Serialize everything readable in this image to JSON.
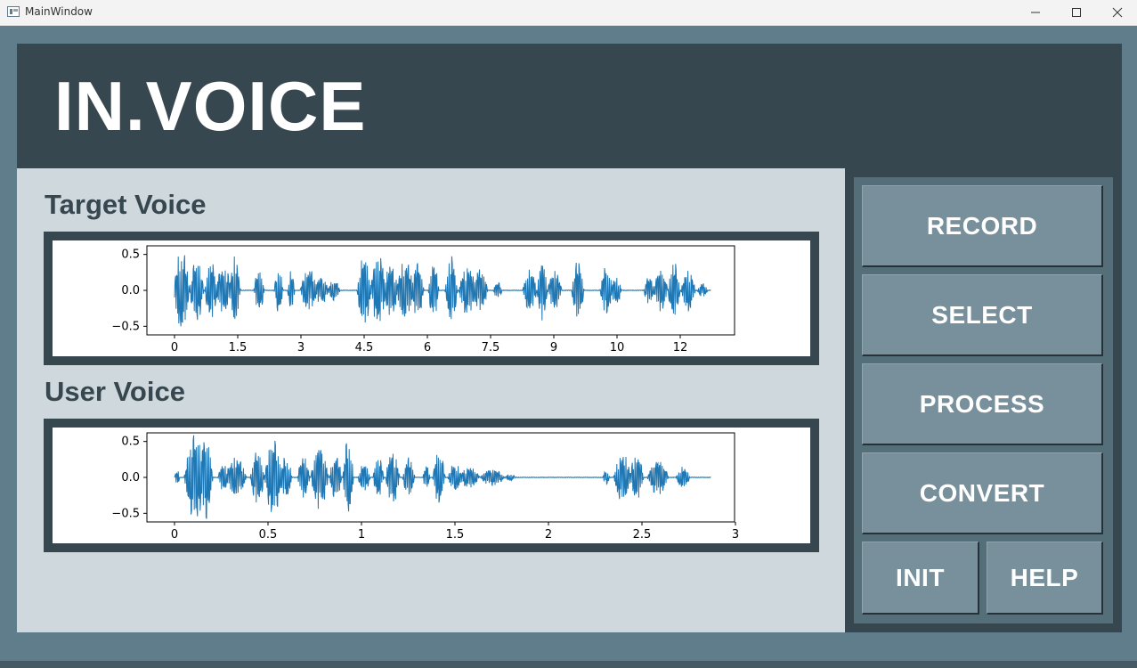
{
  "window": {
    "title": "MainWindow"
  },
  "header": {
    "title": "IN.VOICE"
  },
  "target": {
    "title": "Target Voice",
    "y_ticks": [
      "0.5",
      "0.0",
      "−0.5"
    ],
    "x_ticks": [
      "0",
      "1.5",
      "3",
      "4.5",
      "6",
      "7.5",
      "9",
      "10",
      "12"
    ]
  },
  "user": {
    "title": "User Voice",
    "y_ticks": [
      "0.5",
      "0.0",
      "−0.5"
    ],
    "x_ticks": [
      "0",
      "0.5",
      "1",
      "1.5",
      "2",
      "2.5",
      "3"
    ]
  },
  "buttons": {
    "record": "RECORD",
    "select": "SELECT",
    "process": "PROCESS",
    "convert": "CONVERT",
    "init": "INIT",
    "help": "HELP"
  },
  "colors": {
    "waveform": "#1f77b4",
    "header_bg": "#37474f",
    "panel_bg": "#cfd8dc",
    "button_bg": "#78909c"
  }
}
